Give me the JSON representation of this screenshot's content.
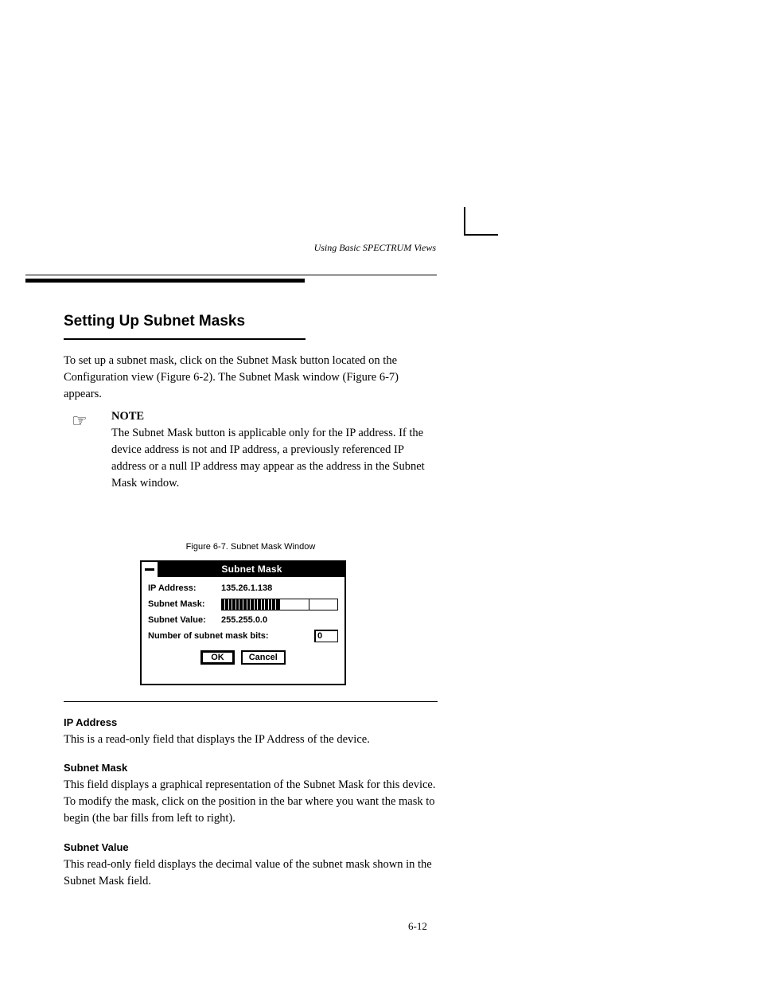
{
  "header": {
    "right_text": "Using Basic SPECTRUM Views"
  },
  "section": {
    "title": "Setting Up Subnet Masks"
  },
  "para1": "To set up a subnet mask, click on the Subnet Mask button located on the Configuration view (Figure 6-2). The Subnet Mask window (Figure 6-7) appears.",
  "note": {
    "bold": "NOTE",
    "body": "The Subnet Mask button is applicable only for the IP address. If the device address is not and IP address, a previously referenced IP address or a null IP address may appear as the address in the Subnet Mask window."
  },
  "figure": {
    "caption": "Figure 6-7. Subnet Mask Window"
  },
  "dialog": {
    "title": "Subnet Mask",
    "rows": {
      "ip_label": "IP Address:",
      "ip_value": "135.26.1.138",
      "mask_label": "Subnet Mask:",
      "value_label": "Subnet Value:",
      "value_value": "255.255.0.0",
      "bits_label": "Number of subnet mask bits:",
      "bits_value": "0"
    },
    "buttons": {
      "ok": "OK",
      "cancel": "Cancel"
    },
    "mask_filled_segments": 16,
    "mask_total_bits": 32
  },
  "fields": {
    "f1_title": "IP Address",
    "f1_body": "This is a read-only field that displays the IP Address of the device.",
    "f2_title": "Subnet Mask",
    "f2_body": "This field displays a graphical representation of the Subnet Mask for this device. To modify the mask, click on the position in the bar where you want the mask to begin (the bar fills from left to right).",
    "f3_title": "Subnet Value",
    "f3_body": "This read-only field displays the decimal value of the subnet mask shown in the Subnet Mask field."
  },
  "page_number": "6-12"
}
